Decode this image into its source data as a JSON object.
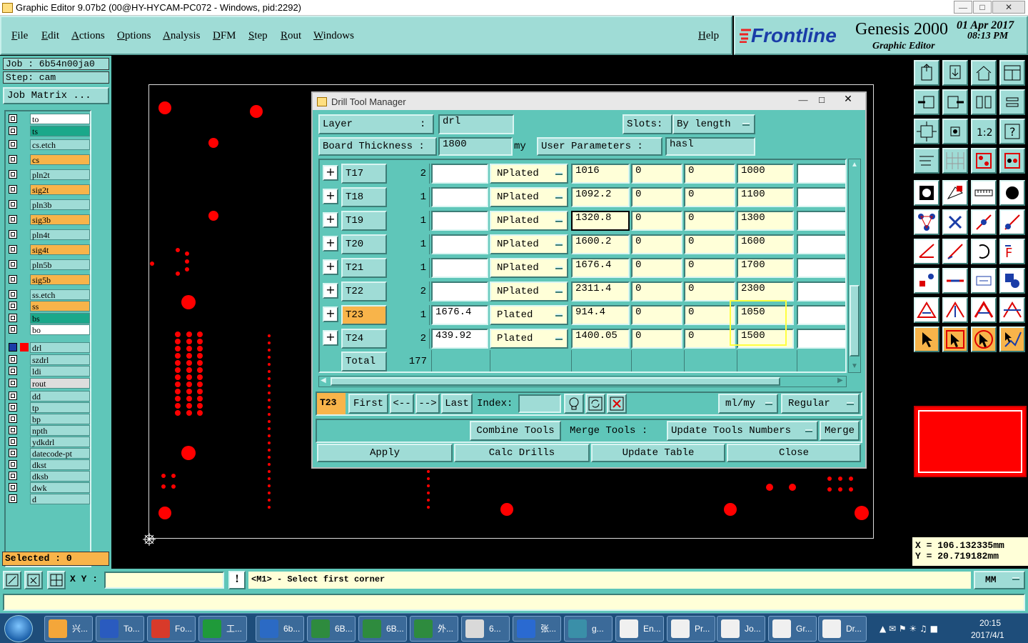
{
  "window": {
    "title": "Graphic Editor 9.07b2 (00@HY-HYCAM-PC072 - Windows, pid:2292)"
  },
  "menu": {
    "items": [
      "File",
      "Edit",
      "Actions",
      "Options",
      "Analysis",
      "DFM",
      "Step",
      "Rout",
      "Windows"
    ],
    "help": "Help"
  },
  "brand": {
    "company": "Frontline",
    "product": "Genesis 2000",
    "subtitle": "Graphic Editor",
    "date": "01 Apr 2017",
    "time": "08:13 PM"
  },
  "job": {
    "job_label": "Job  : 6b54n00ja0",
    "step_label": "Step: cam",
    "matrix_button": "Job Matrix ..."
  },
  "layers": {
    "group1": [
      {
        "name": "to",
        "color": "#ffffff"
      },
      {
        "name": "ts",
        "color": "#1aa88a"
      }
    ],
    "group2": [
      {
        "name": "cs.etch",
        "color": "#9fdcd6"
      },
      {
        "name": "cs",
        "color": "#f8b44a"
      },
      {
        "name": "pln2t",
        "color": "#9fdcd6"
      },
      {
        "name": "sig2t",
        "color": "#f8b44a"
      },
      {
        "name": "pln3b",
        "color": "#9fdcd6"
      },
      {
        "name": "sig3b",
        "color": "#f8b44a"
      },
      {
        "name": "pln4t",
        "color": "#9fdcd6"
      },
      {
        "name": "sig4t",
        "color": "#f8b44a"
      },
      {
        "name": "pln5b",
        "color": "#9fdcd6"
      },
      {
        "name": "sig5b",
        "color": "#f8b44a"
      },
      {
        "name": "ss.etch",
        "color": "#9fdcd6"
      }
    ],
    "group3": [
      {
        "name": "ss",
        "color": "#f8b44a"
      },
      {
        "name": "bs",
        "color": "#1aa88a"
      },
      {
        "name": "bo",
        "color": "#ffffff"
      }
    ],
    "group4": [
      {
        "name": "drl",
        "color": "#9fdcd6"
      },
      {
        "name": "szdrl",
        "color": "#9fdcd6"
      },
      {
        "name": "ldi",
        "color": "#9fdcd6"
      },
      {
        "name": "rout",
        "color": "#dddddd"
      }
    ],
    "group5": [
      {
        "name": "dd",
        "color": "#9fdcd6"
      },
      {
        "name": "tp",
        "color": "#9fdcd6"
      },
      {
        "name": "bp",
        "color": "#9fdcd6"
      },
      {
        "name": "npth",
        "color": "#9fdcd6"
      },
      {
        "name": "ydkdrl",
        "color": "#9fdcd6"
      },
      {
        "name": "datecode-pt",
        "color": "#9fdcd6"
      },
      {
        "name": "dkst",
        "color": "#9fdcd6"
      },
      {
        "name": "dksb",
        "color": "#9fdcd6"
      },
      {
        "name": "dwk",
        "color": "#9fdcd6"
      },
      {
        "name": "d",
        "color": "#9fdcd6"
      }
    ]
  },
  "selected": "Selected : 0",
  "dialog": {
    "title": "Drill Tool Manager",
    "layer_label": "Layer",
    "layer_colon": ":",
    "layer_value": "drl",
    "slots_label": "Slots:",
    "slots_value": "By length",
    "thickness_label": "Board Thickness :",
    "thickness_value": "1800",
    "thickness_unit": "my",
    "user_params_label": "User Parameters :",
    "user_params_value": "hasl",
    "rows": [
      {
        "tool": "T17",
        "count": "2",
        "finish": "",
        "type": "NPlated",
        "drill": "1016",
        "min": "0",
        "max": "0",
        "size": "1000",
        "extra": ""
      },
      {
        "tool": "T18",
        "count": "1",
        "finish": "",
        "type": "NPlated",
        "drill": "1092.2",
        "min": "0",
        "max": "0",
        "size": "1100",
        "extra": ""
      },
      {
        "tool": "T19",
        "count": "1",
        "finish": "",
        "type": "NPlated",
        "drill": "1320.8",
        "min": "0",
        "max": "0",
        "size": "1300",
        "extra": ""
      },
      {
        "tool": "T20",
        "count": "1",
        "finish": "",
        "type": "NPlated",
        "drill": "1600.2",
        "min": "0",
        "max": "0",
        "size": "1600",
        "extra": ""
      },
      {
        "tool": "T21",
        "count": "1",
        "finish": "",
        "type": "NPlated",
        "drill": "1676.4",
        "min": "0",
        "max": "0",
        "size": "1700",
        "extra": ""
      },
      {
        "tool": "T22",
        "count": "2",
        "finish": "",
        "type": "NPlated",
        "drill": "2311.4",
        "min": "0",
        "max": "0",
        "size": "2300",
        "extra": ""
      },
      {
        "tool": "T23",
        "count": "1",
        "finish": "1676.4",
        "type": "Plated",
        "drill": "914.4",
        "min": "0",
        "max": "0",
        "size": "1050",
        "extra": ""
      },
      {
        "tool": "T24",
        "count": "2",
        "finish": "439.92",
        "type": "Plated",
        "drill": "1400.05",
        "min": "0",
        "max": "0",
        "size": "1500",
        "extra": ""
      }
    ],
    "total_label": "Total",
    "total_value": "177",
    "nav": {
      "current": "T23",
      "first": "First",
      "prev": "<--",
      "next": "-->",
      "last": "Last",
      "index_label": "Index:",
      "units": "ml/my",
      "mode": "Regular"
    },
    "actions": {
      "combine": "Combine Tools",
      "merge_label": "Merge Tools :",
      "update_numbers": "Update Tools Numbers",
      "merge": "Merge"
    },
    "footer": {
      "apply": "Apply",
      "calc": "Calc Drills",
      "update_table": "Update Table",
      "close": "Close"
    }
  },
  "coords": {
    "x": "X  = 106.132335mm",
    "y": "Y  = 20.719182mm"
  },
  "statusbar": {
    "xy_label": "X Y :",
    "message": "<M1> - Select first corner",
    "units": "MM"
  },
  "taskbar": {
    "items": [
      {
        "label": "兴...",
        "color": "#f4a63a"
      },
      {
        "label": "To...",
        "color": "#2a5bbf"
      },
      {
        "label": "Fo...",
        "color": "#d83a2a"
      },
      {
        "label": "工...",
        "color": "#1f9a3a"
      },
      {
        "label": "6b...",
        "color": "#2b6ac4"
      },
      {
        "label": "6B...",
        "color": "#2e8b3e"
      },
      {
        "label": "6B...",
        "color": "#2e8b3e"
      },
      {
        "label": "外...",
        "color": "#2e8b3e"
      },
      {
        "label": "6...",
        "color": "#d9d9d9"
      },
      {
        "label": "张...",
        "color": "#2a6ad1"
      },
      {
        "label": "g...",
        "color": "#3a8fa8"
      },
      {
        "label": "En...",
        "color": "#f0f0f0"
      },
      {
        "label": "Pr...",
        "color": "#f0f0f0"
      },
      {
        "label": "Jo...",
        "color": "#f0f0f0"
      },
      {
        "label": "Gr...",
        "color": "#f0f0f0"
      },
      {
        "label": "Dr...",
        "color": "#f0f0f0"
      }
    ],
    "clock_time": "20:15",
    "clock_date": "2017/4/1"
  }
}
